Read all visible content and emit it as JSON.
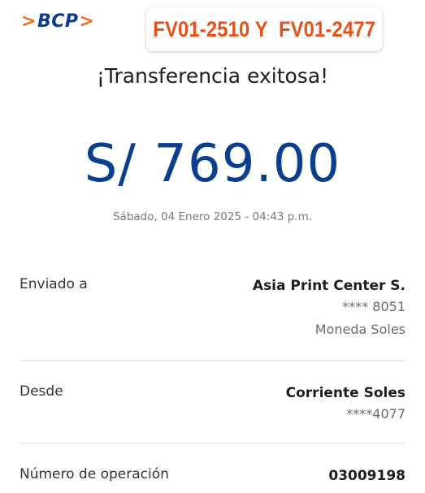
{
  "header": {
    "logo_text": "BCP",
    "logo_left_chevron": ">",
    "logo_right_chevron": ">",
    "stamp_text": "FV01-2510 Y  FV01-2477"
  },
  "receipt": {
    "title": "¡Transferencia exitosa!",
    "amount": "S/ 769.00",
    "datetime": "Sábado, 04 Enero 2025 - 04:43 p.m."
  },
  "details": {
    "sent_to": {
      "label": "Enviado a",
      "name": "Asia Print Center S.",
      "account": "**** 8051",
      "currency": "Moneda Soles"
    },
    "from": {
      "label": "Desde",
      "account_type": "Corriente Soles",
      "account": "****4077"
    },
    "operation": {
      "label": "Número de operación",
      "number": "03009198"
    }
  },
  "colors": {
    "brand_blue": "#0a3b8c",
    "brand_orange": "#f26a21",
    "stamp_orange": "#e6511a",
    "amount_blue": "#0a3f8f"
  }
}
